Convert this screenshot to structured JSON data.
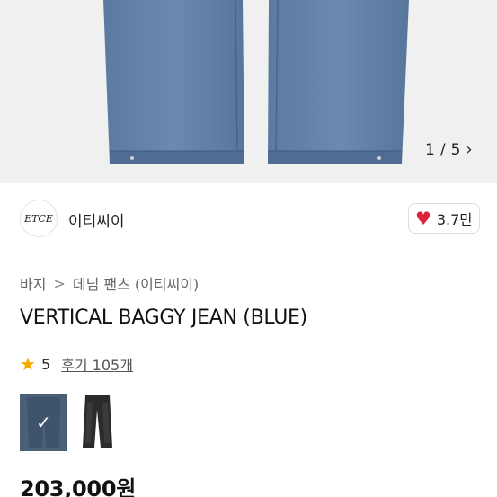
{
  "gallery": {
    "current_page": "1",
    "page_separator": "/",
    "total_pages": "5",
    "next_icon": "chevron-right-icon"
  },
  "brand": {
    "logo_text": "ETCE",
    "name": "이티씨이",
    "likes_label": "3.7만",
    "like_icon": "heart-icon",
    "like_color": "#e0223a"
  },
  "breadcrumb": {
    "category": "바지",
    "separator": ">",
    "subcategory": "데님 팬츠 (이티씨이)"
  },
  "product": {
    "title": "VERTICAL BAGGY JEAN (BLUE)",
    "rating_icon": "star-icon",
    "rating": "5",
    "reviews_label": "후기 105개",
    "price": "203,000원"
  },
  "variants": [
    {
      "color_name": "blue",
      "selected": true,
      "swatch": "#4b6075",
      "check_glyph": "✓"
    },
    {
      "color_name": "black",
      "selected": false,
      "swatch": "#2b2b2b"
    }
  ],
  "colors": {
    "denim": "#5e7fa6",
    "star": "#f2a900",
    "hero_bg": "#f0f0f0"
  }
}
